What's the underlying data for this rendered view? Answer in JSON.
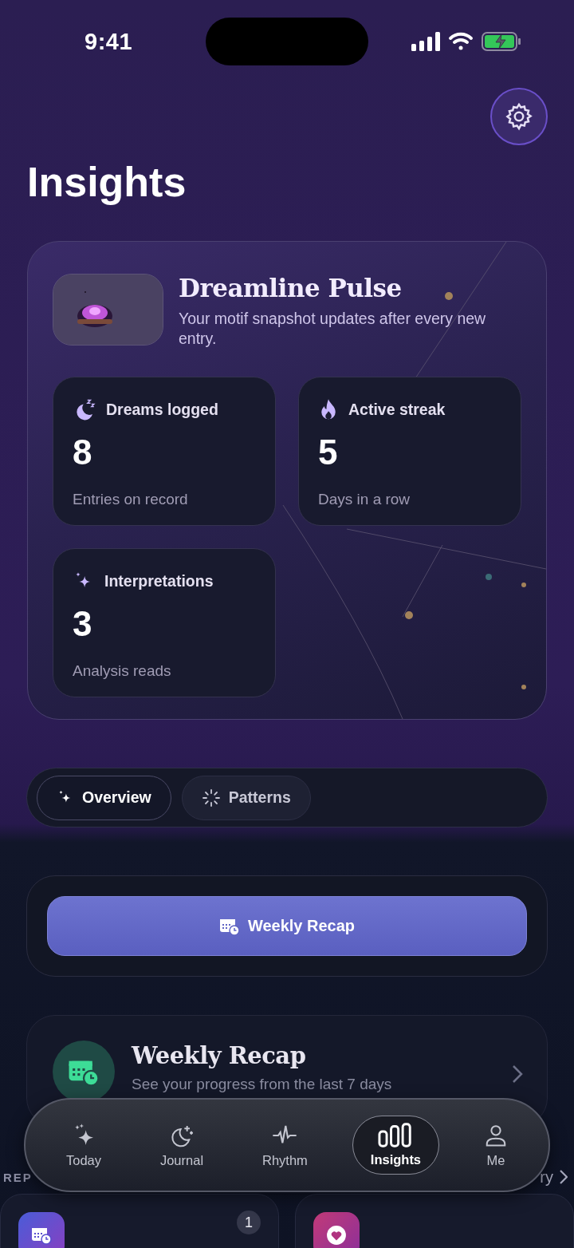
{
  "status_bar": {
    "time": "9:41"
  },
  "header": {
    "title": "Insights"
  },
  "pulse": {
    "title": "Dreamline Pulse",
    "subtitle": "Your motif snapshot updates after every new entry.",
    "stats": [
      {
        "label": "Dreams logged",
        "value": "8",
        "caption": "Entries on record"
      },
      {
        "label": "Active streak",
        "value": "5",
        "caption": "Days in a row"
      },
      {
        "label": "Interpretations",
        "value": "3",
        "caption": "Analysis reads"
      }
    ]
  },
  "segments": [
    {
      "label": "Overview",
      "selected": true
    },
    {
      "label": "Patterns",
      "selected": false
    }
  ],
  "action_button": {
    "label": "Weekly Recap"
  },
  "feature_card": {
    "title": "Weekly Recap",
    "subtitle": "See your progress from the last 7 days"
  },
  "section": {
    "title": "REP",
    "link": "ry"
  },
  "report_cards": [
    {
      "kind": "calendar",
      "badge": "1"
    },
    {
      "kind": "heart"
    }
  ],
  "tab_bar": [
    {
      "label": "Today",
      "selected": false
    },
    {
      "label": "Journal",
      "selected": false
    },
    {
      "label": "Rhythm",
      "selected": false
    },
    {
      "label": "Insights",
      "selected": true
    },
    {
      "label": "Me",
      "selected": false
    }
  ]
}
